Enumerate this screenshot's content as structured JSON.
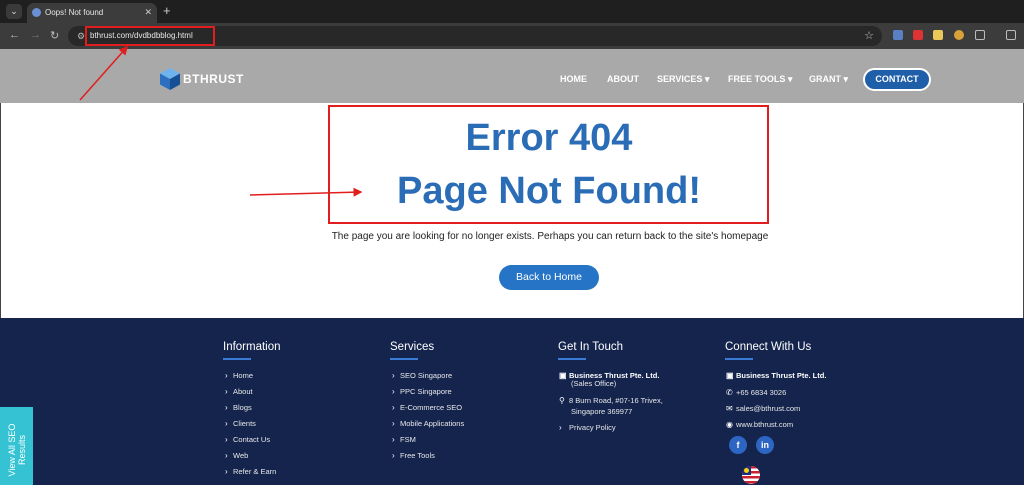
{
  "browser": {
    "tab_title": "Oops! Not found",
    "url": "bthrust.com/dvdbdbblog.html"
  },
  "site": {
    "logo_text": "BTHRUST",
    "menu": [
      "HOME",
      "ABOUT",
      "SERVICES ▾",
      "FREE TOOLS ▾",
      "GRANT ▾"
    ],
    "contact_label": "CONTACT"
  },
  "error": {
    "title": "Error 404",
    "subtitle": "Page Not Found!",
    "message": "The page you are looking for no longer exists. Perhaps you can return back to the site's homepage",
    "button_label": "Back to Home"
  },
  "footer": {
    "information": {
      "heading": "Information",
      "items": [
        "Home",
        "About",
        "Blogs",
        "Clients",
        "Contact Us",
        "Web",
        "Refer & Earn"
      ]
    },
    "services": {
      "heading": "Services",
      "items": [
        "SEO Singapore",
        "PPC Singapore",
        "E-Commerce SEO",
        "Mobile Applications",
        "FSM",
        "Free Tools"
      ]
    },
    "get_in_touch": {
      "heading": "Get In Touch",
      "company": "Business Thrust Pte. Ltd.",
      "office": "(Sales Office)",
      "address1": "8 Burn Road, #07-16 Trivex,",
      "address2": "Singapore 369977",
      "privacy": "Privacy Policy"
    },
    "connect": {
      "heading": "Connect With Us",
      "company": "Business Thrust Pte. Ltd.",
      "phone": "+65 6834 3026",
      "email": "sales@bthrust.com",
      "web": "www.bthrust.com",
      "facebook": "f",
      "linkedin": "in"
    }
  },
  "side_tab": {
    "line1": "View All SEO",
    "line2": "Results"
  },
  "colors": {
    "annotation": "#e01e1e",
    "brand_blue": "#2a6cb5",
    "footer_bg": "#14244d",
    "header_bg": "#a9a9a9"
  }
}
